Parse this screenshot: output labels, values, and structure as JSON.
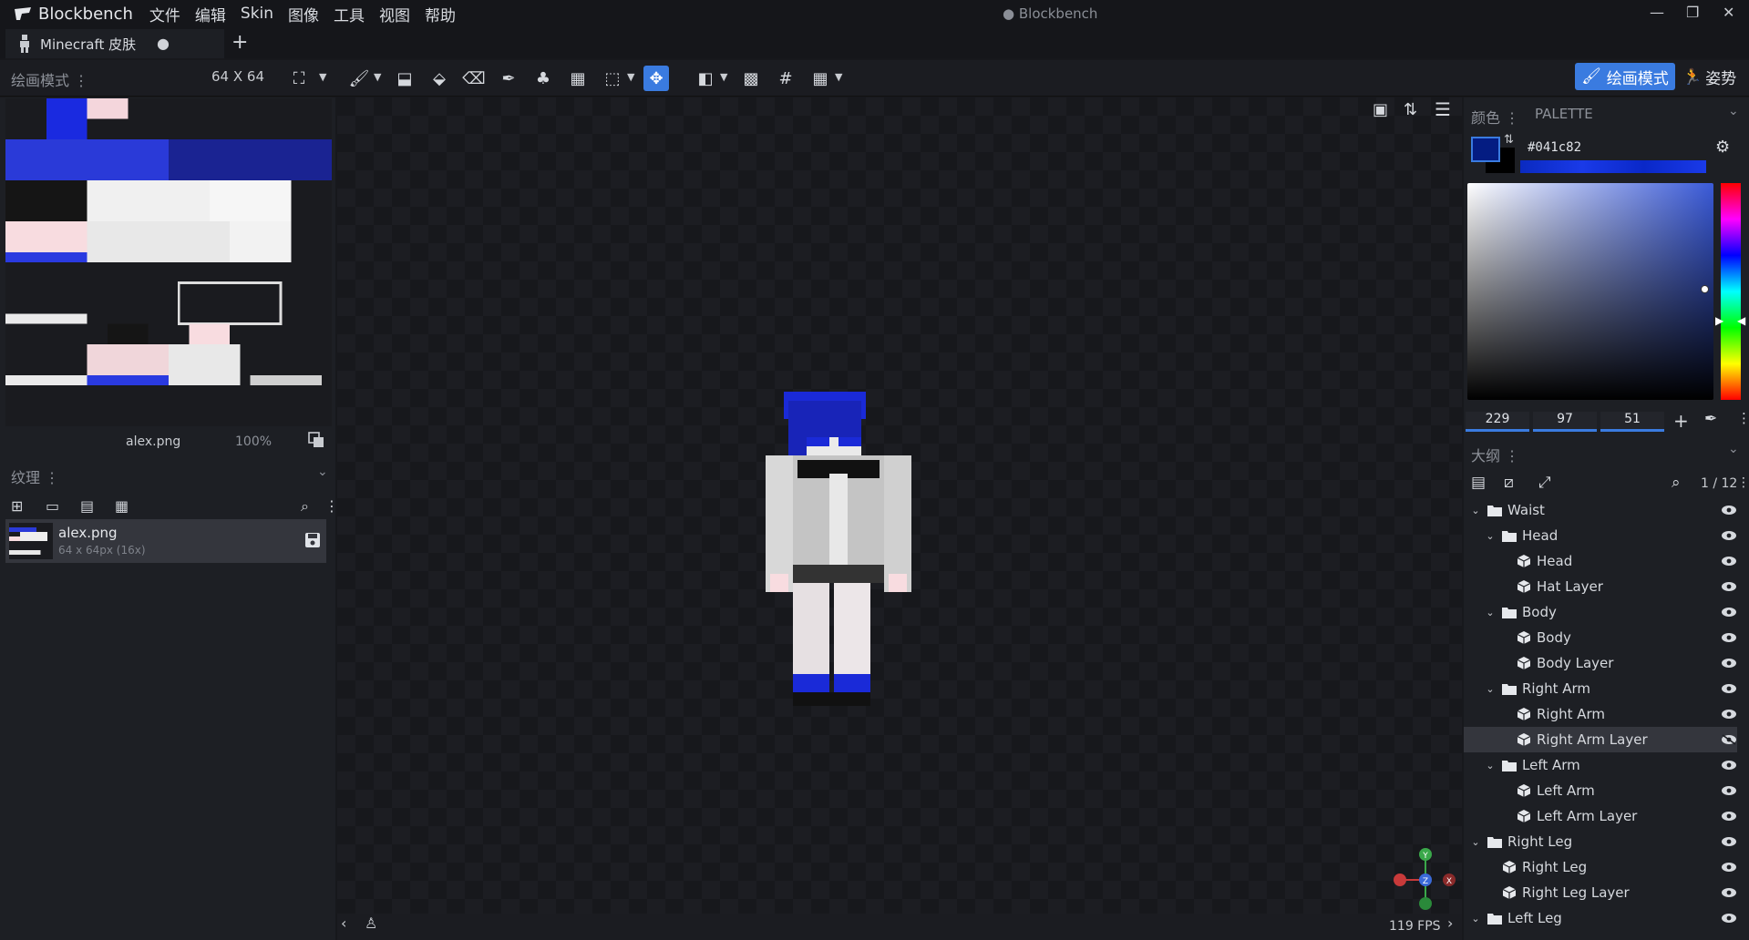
{
  "titlebar": {
    "app_name": "Blockbench",
    "menus": [
      "文件",
      "编辑",
      "Skin",
      "图像",
      "工具",
      "视图",
      "帮助"
    ],
    "window_title": "Blockbench"
  },
  "tab": {
    "label": "Minecraft 皮肤",
    "dot": "●",
    "new_tab": "+"
  },
  "toolbar": {
    "mode_label": "绘画模式",
    "canvas_size": "64 X 64",
    "paint_mode_label": "绘画模式",
    "pose_label": "姿势"
  },
  "texture_preview": {
    "file_name": "alex.png",
    "zoom": "100%"
  },
  "textures_panel": {
    "title": "纹理",
    "items": [
      {
        "name": "alex.png",
        "size": "64 x 64px (16x)"
      }
    ]
  },
  "viewport": {
    "fps": "119 FPS"
  },
  "color_panel": {
    "title": "颜色",
    "palette_tab": "PALETTE",
    "hex": "#041c82",
    "primary_color": "#041c82",
    "r": "229",
    "g": "97",
    "b": "51"
  },
  "outliner": {
    "title": "大纲",
    "count": "1 / 12",
    "items": [
      {
        "label": "Waist",
        "type": "folder",
        "depth": 0,
        "selected": false
      },
      {
        "label": "Head",
        "type": "folder",
        "depth": 1,
        "selected": false
      },
      {
        "label": "Head",
        "type": "cube",
        "depth": 2,
        "selected": false
      },
      {
        "label": "Hat Layer",
        "type": "cube",
        "depth": 2,
        "selected": false
      },
      {
        "label": "Body",
        "type": "folder",
        "depth": 1,
        "selected": false
      },
      {
        "label": "Body",
        "type": "cube",
        "depth": 2,
        "selected": false
      },
      {
        "label": "Body Layer",
        "type": "cube",
        "depth": 2,
        "selected": false
      },
      {
        "label": "Right Arm",
        "type": "folder",
        "depth": 1,
        "selected": false
      },
      {
        "label": "Right Arm",
        "type": "cube",
        "depth": 2,
        "selected": false
      },
      {
        "label": "Right Arm Layer",
        "type": "cube",
        "depth": 2,
        "selected": true
      },
      {
        "label": "Left Arm",
        "type": "folder",
        "depth": 1,
        "selected": false
      },
      {
        "label": "Left Arm",
        "type": "cube",
        "depth": 2,
        "selected": false
      },
      {
        "label": "Left Arm Layer",
        "type": "cube",
        "depth": 2,
        "selected": false
      },
      {
        "label": "Right Leg",
        "type": "folder",
        "depth": 0,
        "selected": false
      },
      {
        "label": "Right Leg",
        "type": "cube",
        "depth": 1,
        "selected": false
      },
      {
        "label": "Right Leg Layer",
        "type": "cube",
        "depth": 1,
        "selected": false
      },
      {
        "label": "Left Leg",
        "type": "folder",
        "depth": 0,
        "selected": false
      }
    ]
  },
  "gizmo": {
    "y": "Y",
    "z": "Z",
    "x": "X"
  }
}
